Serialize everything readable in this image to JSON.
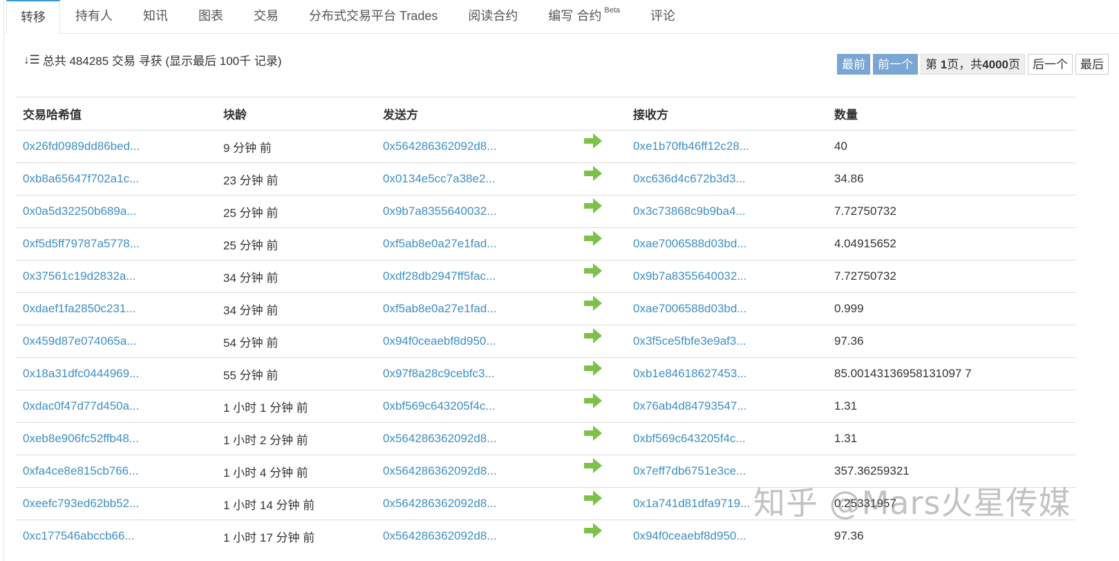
{
  "tabs": [
    {
      "label": "转移",
      "active": true
    },
    {
      "label": "持有人"
    },
    {
      "label": "知讯"
    },
    {
      "label": "图表"
    },
    {
      "label": "交易"
    },
    {
      "label": "分布式交易平台 Trades"
    },
    {
      "label": "阅读合约"
    },
    {
      "label": "编写 合约",
      "badge": "Beta"
    },
    {
      "label": "评论"
    }
  ],
  "summary": {
    "icon": "sort-desc-icon",
    "text": "总共 484285 交易 寻获 (显示最后 100千 记录)"
  },
  "pager": {
    "first": "最前",
    "prev": "前一个",
    "info_prefix": "第 ",
    "page": "1",
    "info_mid": "页，共",
    "total": "4000",
    "info_suffix": "页",
    "next": "后一个",
    "last": "最后"
  },
  "table": {
    "headers": [
      "交易哈希值",
      "块龄",
      "发送方",
      "",
      "接收方",
      "数量"
    ],
    "arrow_color": "#7cc24a",
    "rows": [
      [
        "0x26fd0989dd86bed...",
        "9 分钟 前",
        "0x564286362092d8...",
        "0xe1b70fb46ff12c28...",
        "40"
      ],
      [
        "0xb8a65647f702a1c...",
        "23 分钟 前",
        "0x0134e5cc7a38e2...",
        "0xc636d4c672b3d3...",
        "34.86"
      ],
      [
        "0x0a5d32250b689a...",
        "25 分钟 前",
        "0x9b7a8355640032...",
        "0x3c73868c9b9ba4...",
        "7.72750732"
      ],
      [
        "0xf5d5ff79787a5778...",
        "25 分钟 前",
        "0xf5ab8e0a27e1fad...",
        "0xae7006588d03bd...",
        "4.04915652"
      ],
      [
        "0x37561c19d2832a...",
        "34 分钟 前",
        "0xdf28db2947ff5fac...",
        "0x9b7a8355640032...",
        "7.72750732"
      ],
      [
        "0xdaef1fa2850c231...",
        "34 分钟 前",
        "0xf5ab8e0a27e1fad...",
        "0xae7006588d03bd...",
        "0.999"
      ],
      [
        "0x459d87e074065a...",
        "54 分钟 前",
        "0x94f0ceaebf8d950...",
        "0x3f5ce5fbfe3e9af3...",
        "97.36"
      ],
      [
        "0x18a31dfc0444969...",
        "55 分钟 前",
        "0x97f8a28c9cebfc3...",
        "0xb1e84618627453...",
        "85.00143136958131097 7"
      ],
      [
        "0xdac0f47d77d450a...",
        "1 小时 1 分钟 前",
        "0xbf569c643205f4c...",
        "0x76ab4d84793547...",
        "1.31"
      ],
      [
        "0xeb8e906fc52ffb48...",
        "1 小时 2 分钟 前",
        "0x564286362092d8...",
        "0xbf569c643205f4c...",
        "1.31"
      ],
      [
        "0xfa4ce8e815cb766...",
        "1 小时 4 分钟 前",
        "0x564286362092d8...",
        "0x7eff7db6751e3ce...",
        "357.36259321"
      ],
      [
        "0xeefc793ed62bb52...",
        "1 小时 14 分钟 前",
        "0x564286362092d8...",
        "0x1a741d81dfa9719...",
        "0.25331957"
      ],
      [
        "0xc177546abccb66...",
        "1 小时 17 分钟 前",
        "0x564286362092d8...",
        "0x94f0ceaebf8d950...",
        "97.36"
      ]
    ]
  },
  "watermark": "知乎 @Mars火星传媒"
}
